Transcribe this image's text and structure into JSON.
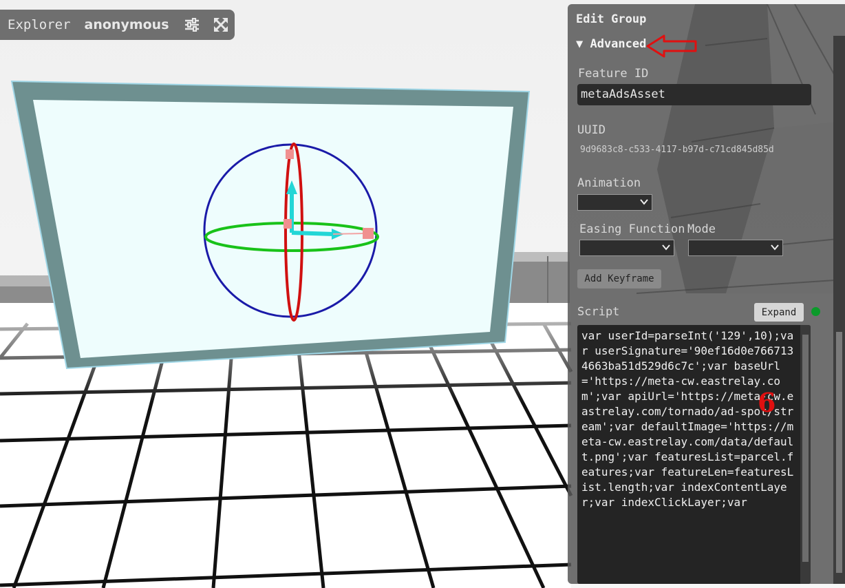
{
  "toolbar": {
    "explorer_label": "Explorer",
    "user_name": "anonymous",
    "settings_icon": "sliders-icon",
    "fullscreen_icon": "expand-icon"
  },
  "panel": {
    "title": "Edit Group",
    "advanced_label": "▼ Advanced",
    "feature_id_label": "Feature ID",
    "feature_id_value": "metaAdsAsset",
    "uuid_label": "UUID",
    "uuid_value": "9d9683c8-c533-4117-b97d-c71cd845d85d",
    "animation_label": "Animation",
    "animation_value": "",
    "easing_label": "Easing Function",
    "easing_value": "",
    "mode_label": "Mode",
    "mode_value": "",
    "add_keyframe_label": "Add Keyframe",
    "script_label": "Script",
    "expand_label": "Expand",
    "script_text": "var userId=parseInt('129',10);var userSignature='90ef16d0e7667134663ba51d529d6c7c';var baseUrl='https://meta-cw.eastrelay.com';var apiUrl='https://meta-cw.eastrelay.com/tornado/ad-spot/stream';var defaultImage='https://meta-cw.eastrelay.com/data/default.png';var featuresList=parcel.features;var featureLen=featuresList.length;var indexContentLayer;var indexClickLayer;var"
  },
  "annotation": {
    "number": "6"
  },
  "colors": {
    "status_dot": "#0b9a2a",
    "annotation": "#e01010",
    "gizmo_blue": "#1a1aa8",
    "gizmo_green": "#19c219",
    "gizmo_red": "#d01010",
    "gizmo_cyan": "#22d6d6"
  }
}
